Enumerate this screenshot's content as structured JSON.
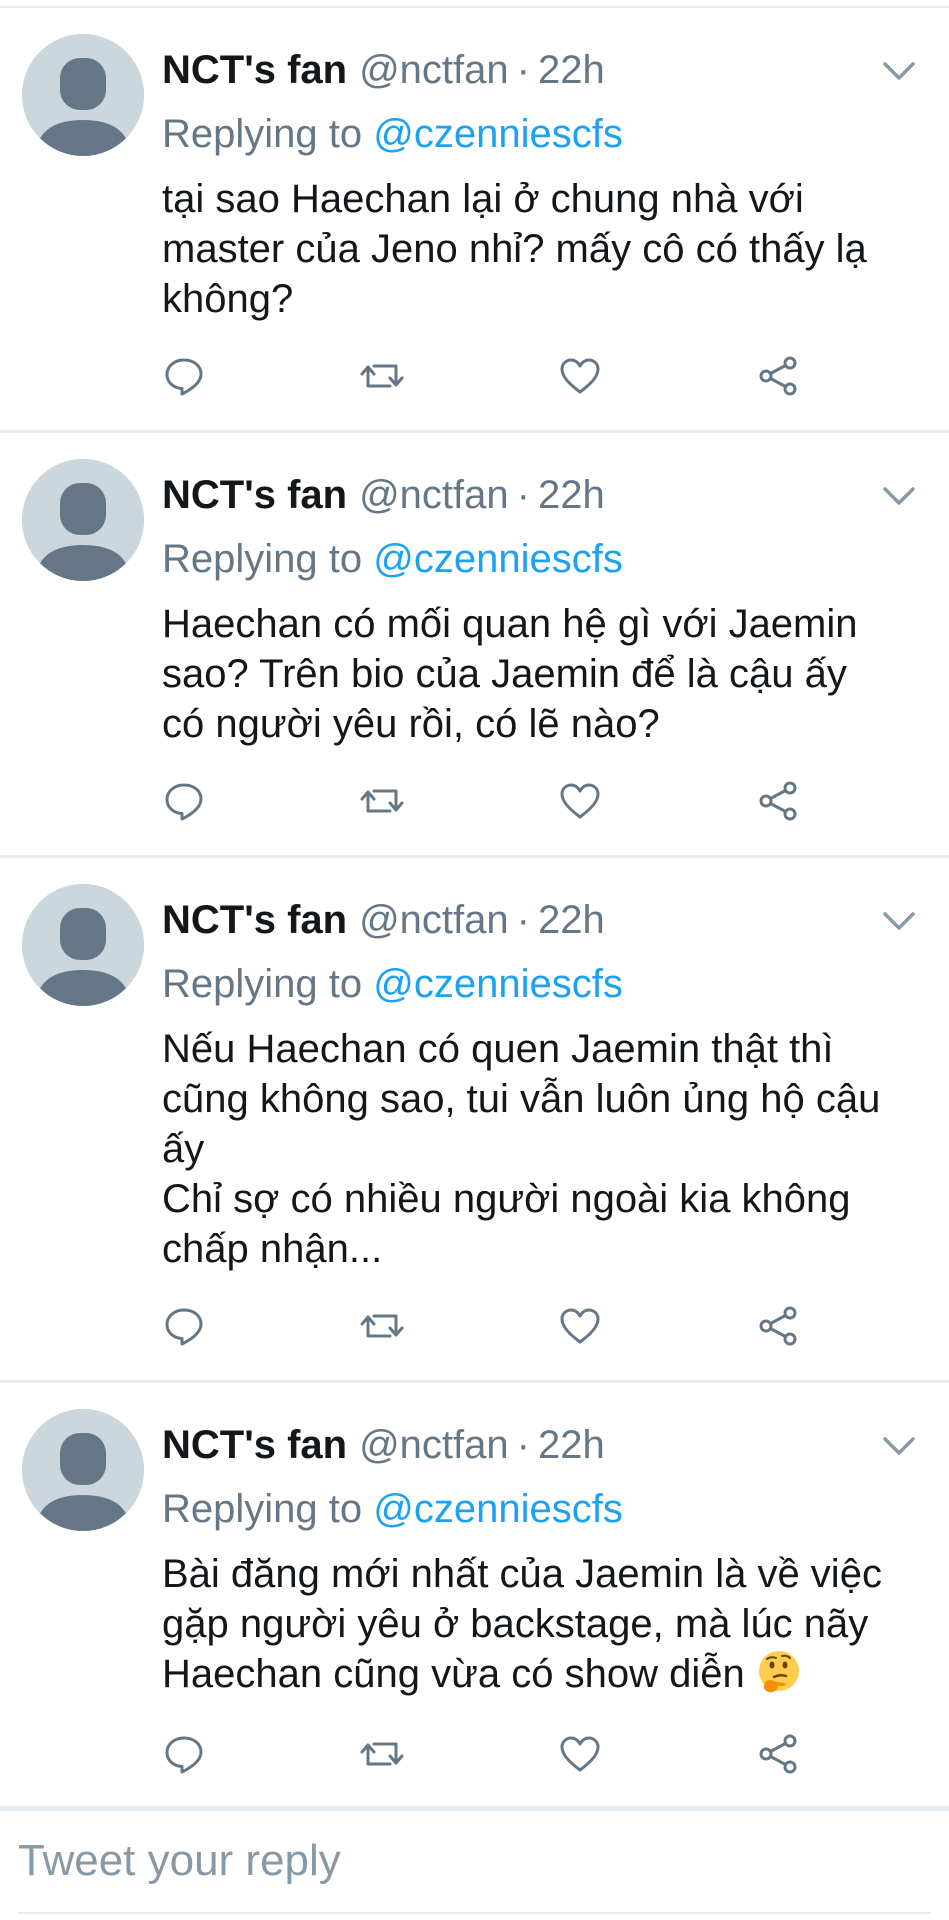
{
  "tweets": [
    {
      "name": "NCT's fan",
      "handle": "@nctfan",
      "separator": "·",
      "time": "22h",
      "replying_prefix": "Replying to ",
      "replying_to": "@czenniescfs",
      "text": "tại sao Haechan lại ở chung nhà với\nmaster của Jeno nhỉ? mấy cô có thấy lạ\nkhông?"
    },
    {
      "name": "NCT's fan",
      "handle": "@nctfan",
      "separator": "·",
      "time": "22h",
      "replying_prefix": "Replying to ",
      "replying_to": "@czenniescfs",
      "text": "Haechan có mối quan hệ gì với Jaemin\nsao? Trên bio của Jaemin để là cậu ấy\ncó người yêu rồi, có lẽ nào?"
    },
    {
      "name": "NCT's fan",
      "handle": "@nctfan",
      "separator": "·",
      "time": "22h",
      "replying_prefix": "Replying to ",
      "replying_to": "@czenniescfs",
      "text": "Nếu Haechan có quen Jaemin thật thì\ncũng không sao, tui vẫn luôn ủng hộ cậu\nấy\nChỉ sợ có nhiều người ngoài kia không\nchấp nhận..."
    },
    {
      "name": "NCT's fan",
      "handle": "@nctfan",
      "separator": "·",
      "time": "22h",
      "replying_prefix": "Replying to ",
      "replying_to": "@czenniescfs",
      "text": "Bài đăng mới nhất của Jaemin là về việc\ngặp người yêu ở backstage, mà lúc nãy\nHaechan cũng vừa có show diễn ",
      "emoji": "thinking-face-emoji"
    }
  ],
  "actions": {
    "reply_icon": "reply-icon",
    "retweet_icon": "retweet-icon",
    "like_icon": "heart-icon",
    "share_icon": "share-icon",
    "menu_icon": "chevron-down-icon"
  },
  "compose": {
    "placeholder": "Tweet your reply",
    "value": ""
  },
  "colors": {
    "link": "#1da1f2",
    "muted": "#657786",
    "divider": "#e6ecf0",
    "avatar_bg": "#ccd6dd",
    "avatar_fg": "#657786"
  }
}
